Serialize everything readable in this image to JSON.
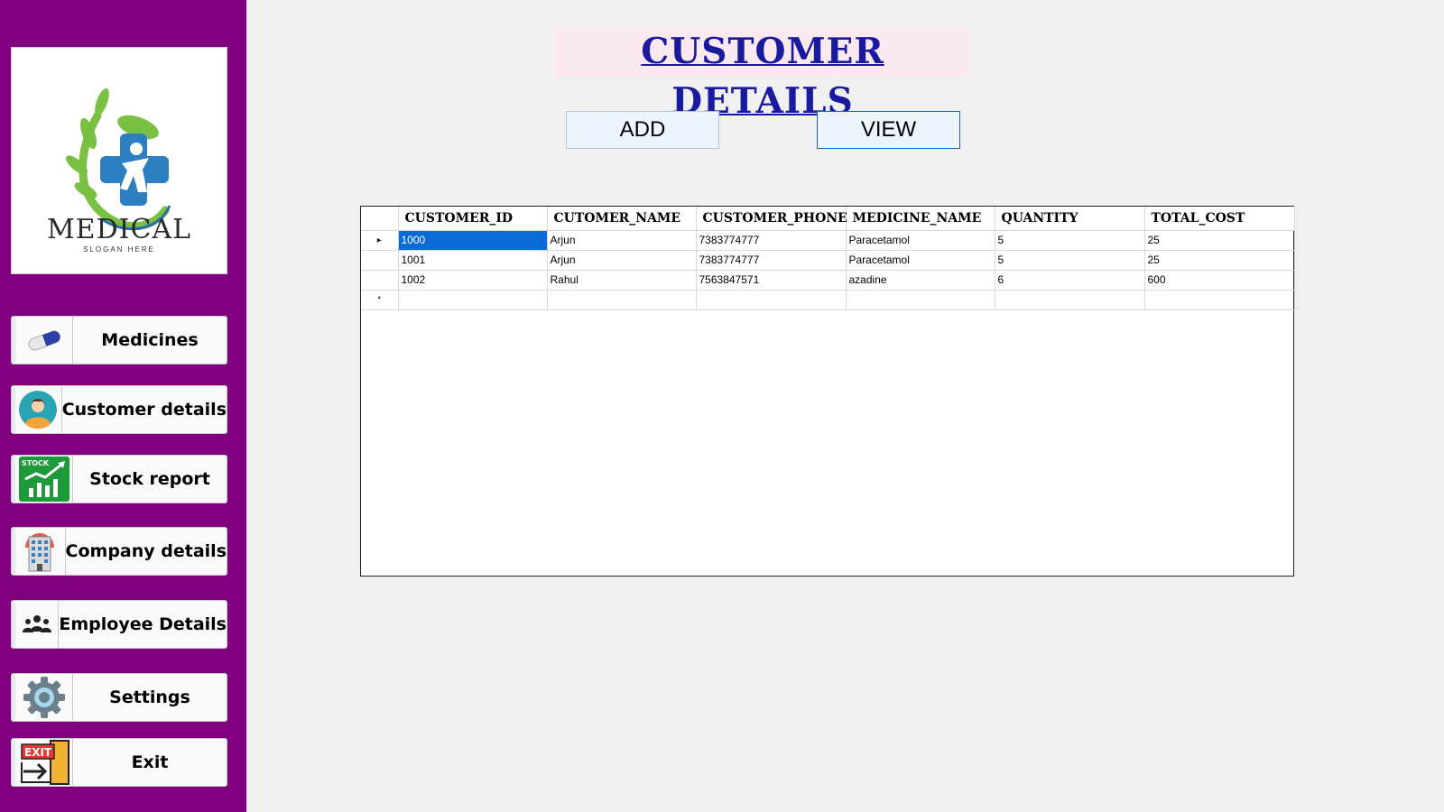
{
  "sidebar": {
    "logo": {
      "brand": "MEDICAL",
      "slogan": "SLOGAN HERE"
    },
    "items": [
      {
        "label": "Medicines",
        "icon": "capsule-icon"
      },
      {
        "label": "Customer details",
        "icon": "customer-avatar-icon"
      },
      {
        "label": "Stock report",
        "icon": "stock-chart-icon"
      },
      {
        "label": "Company details",
        "icon": "building-icon"
      },
      {
        "label": "Employee Details",
        "icon": "team-icon"
      },
      {
        "label": "Settings",
        "icon": "gear-icon"
      },
      {
        "label": "Exit",
        "icon": "exit-door-icon"
      }
    ],
    "color": "#800080"
  },
  "main": {
    "title": "CUSTOMER DETAILS",
    "add_label": "ADD",
    "view_label": "VIEW",
    "grid": {
      "columns": [
        "CUSTOMER_ID",
        "CUTOMER_NAME",
        "CUSTOMER_PHONE",
        "MEDICINE_NAME",
        "QUANTITY",
        "TOTAL_COST"
      ],
      "rows": [
        [
          "1000",
          "Arjun",
          "7383774777",
          "Paracetamol",
          "5",
          "25"
        ],
        [
          "1001",
          "Arjun",
          "7383774777",
          "Paracetamol",
          "5",
          "25"
        ],
        [
          "1002",
          "Rahul",
          "7563847571",
          "azadine",
          "6",
          "600"
        ]
      ],
      "current_row_marker": "▸",
      "new_row_marker": "*",
      "selection_color": "#0a6ad6"
    }
  }
}
